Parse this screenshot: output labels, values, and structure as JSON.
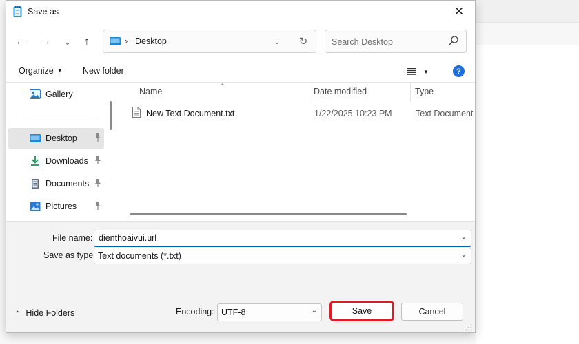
{
  "dialog": {
    "title": "Save as",
    "close_glyph": "✕"
  },
  "nav": {
    "back_glyph": "←",
    "forward_glyph": "→",
    "recent_glyph": "⌄",
    "up_glyph": "↑",
    "path_separator": "›",
    "location": "Desktop",
    "dropdown_glyph": "⌄",
    "refresh_glyph": "↻",
    "search_placeholder": "Search Desktop"
  },
  "commands": {
    "organize": "Organize",
    "new_folder": "New folder",
    "help_glyph": "?"
  },
  "sidebar": {
    "items": [
      {
        "label": "Gallery",
        "icon": "gallery-icon",
        "pinned": false,
        "selected": false
      },
      {
        "label": "Desktop",
        "icon": "desktop-icon",
        "pinned": true,
        "selected": true
      },
      {
        "label": "Downloads",
        "icon": "downloads-icon",
        "pinned": true,
        "selected": false
      },
      {
        "label": "Documents",
        "icon": "documents-icon",
        "pinned": true,
        "selected": false
      },
      {
        "label": "Pictures",
        "icon": "pictures-icon",
        "pinned": true,
        "selected": false
      }
    ]
  },
  "files": {
    "columns": [
      "Name",
      "Date modified",
      "Type"
    ],
    "rows": [
      {
        "name": "New Text Document.txt",
        "date_modified": "1/22/2025 10:23 PM",
        "type": "Text Document",
        "icon": "text-file-icon"
      }
    ]
  },
  "form": {
    "file_name_label": "File name:",
    "file_name_value": "dienthoaivui.url",
    "save_type_label": "Save as type:",
    "save_type_value": "Text documents (*.txt)",
    "encoding_label": "Encoding:",
    "encoding_value": "UTF-8",
    "save_label": "Save",
    "cancel_label": "Cancel",
    "hide_folders_label": "Hide Folders"
  },
  "colors": {
    "accent": "#0063b1",
    "highlight_box": "#e01b24",
    "help_icon": "#1f6fdb",
    "selection": "#e5e5e5"
  }
}
